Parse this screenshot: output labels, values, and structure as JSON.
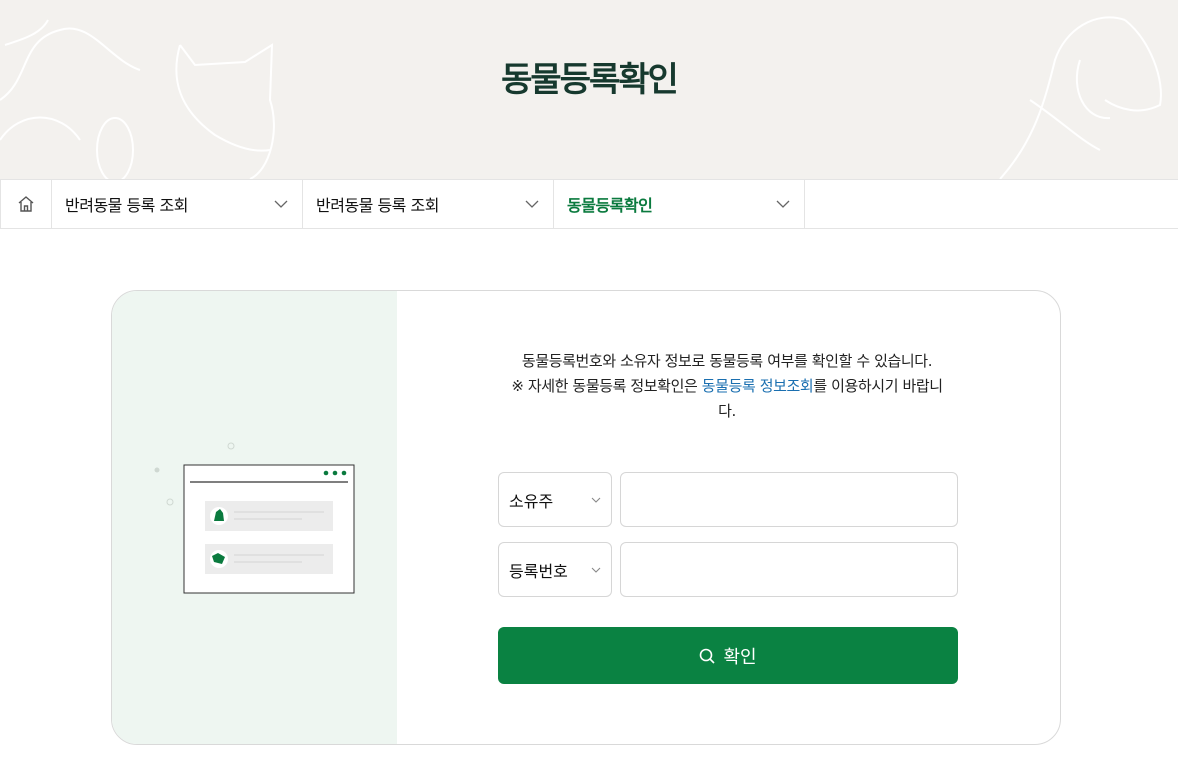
{
  "hero": {
    "title": "동물등록확인"
  },
  "breadcrumb": {
    "home_icon": "home-icon",
    "items": [
      {
        "label": "반려동물 등록 조회"
      },
      {
        "label": "반려동물 등록 조회"
      },
      {
        "label": "동물등록확인"
      }
    ]
  },
  "form": {
    "description_line1": "동물등록번호와 소유자 정보로 동물등록 여부를 확인할 수 있습니다.",
    "description_prefix": "※ 자세한 동물등록 정보확인은 ",
    "description_link": "동물등록 정보조회",
    "description_suffix": "를 이용하시기 바랍니다.",
    "field1": {
      "select_value": "소유주",
      "input_value": ""
    },
    "field2": {
      "select_value": "등록번호",
      "input_value": ""
    },
    "submit_label": "확인"
  },
  "colors": {
    "brand_green": "#0a8242",
    "title_green": "#16392e",
    "link_blue": "#1a6fb0"
  }
}
